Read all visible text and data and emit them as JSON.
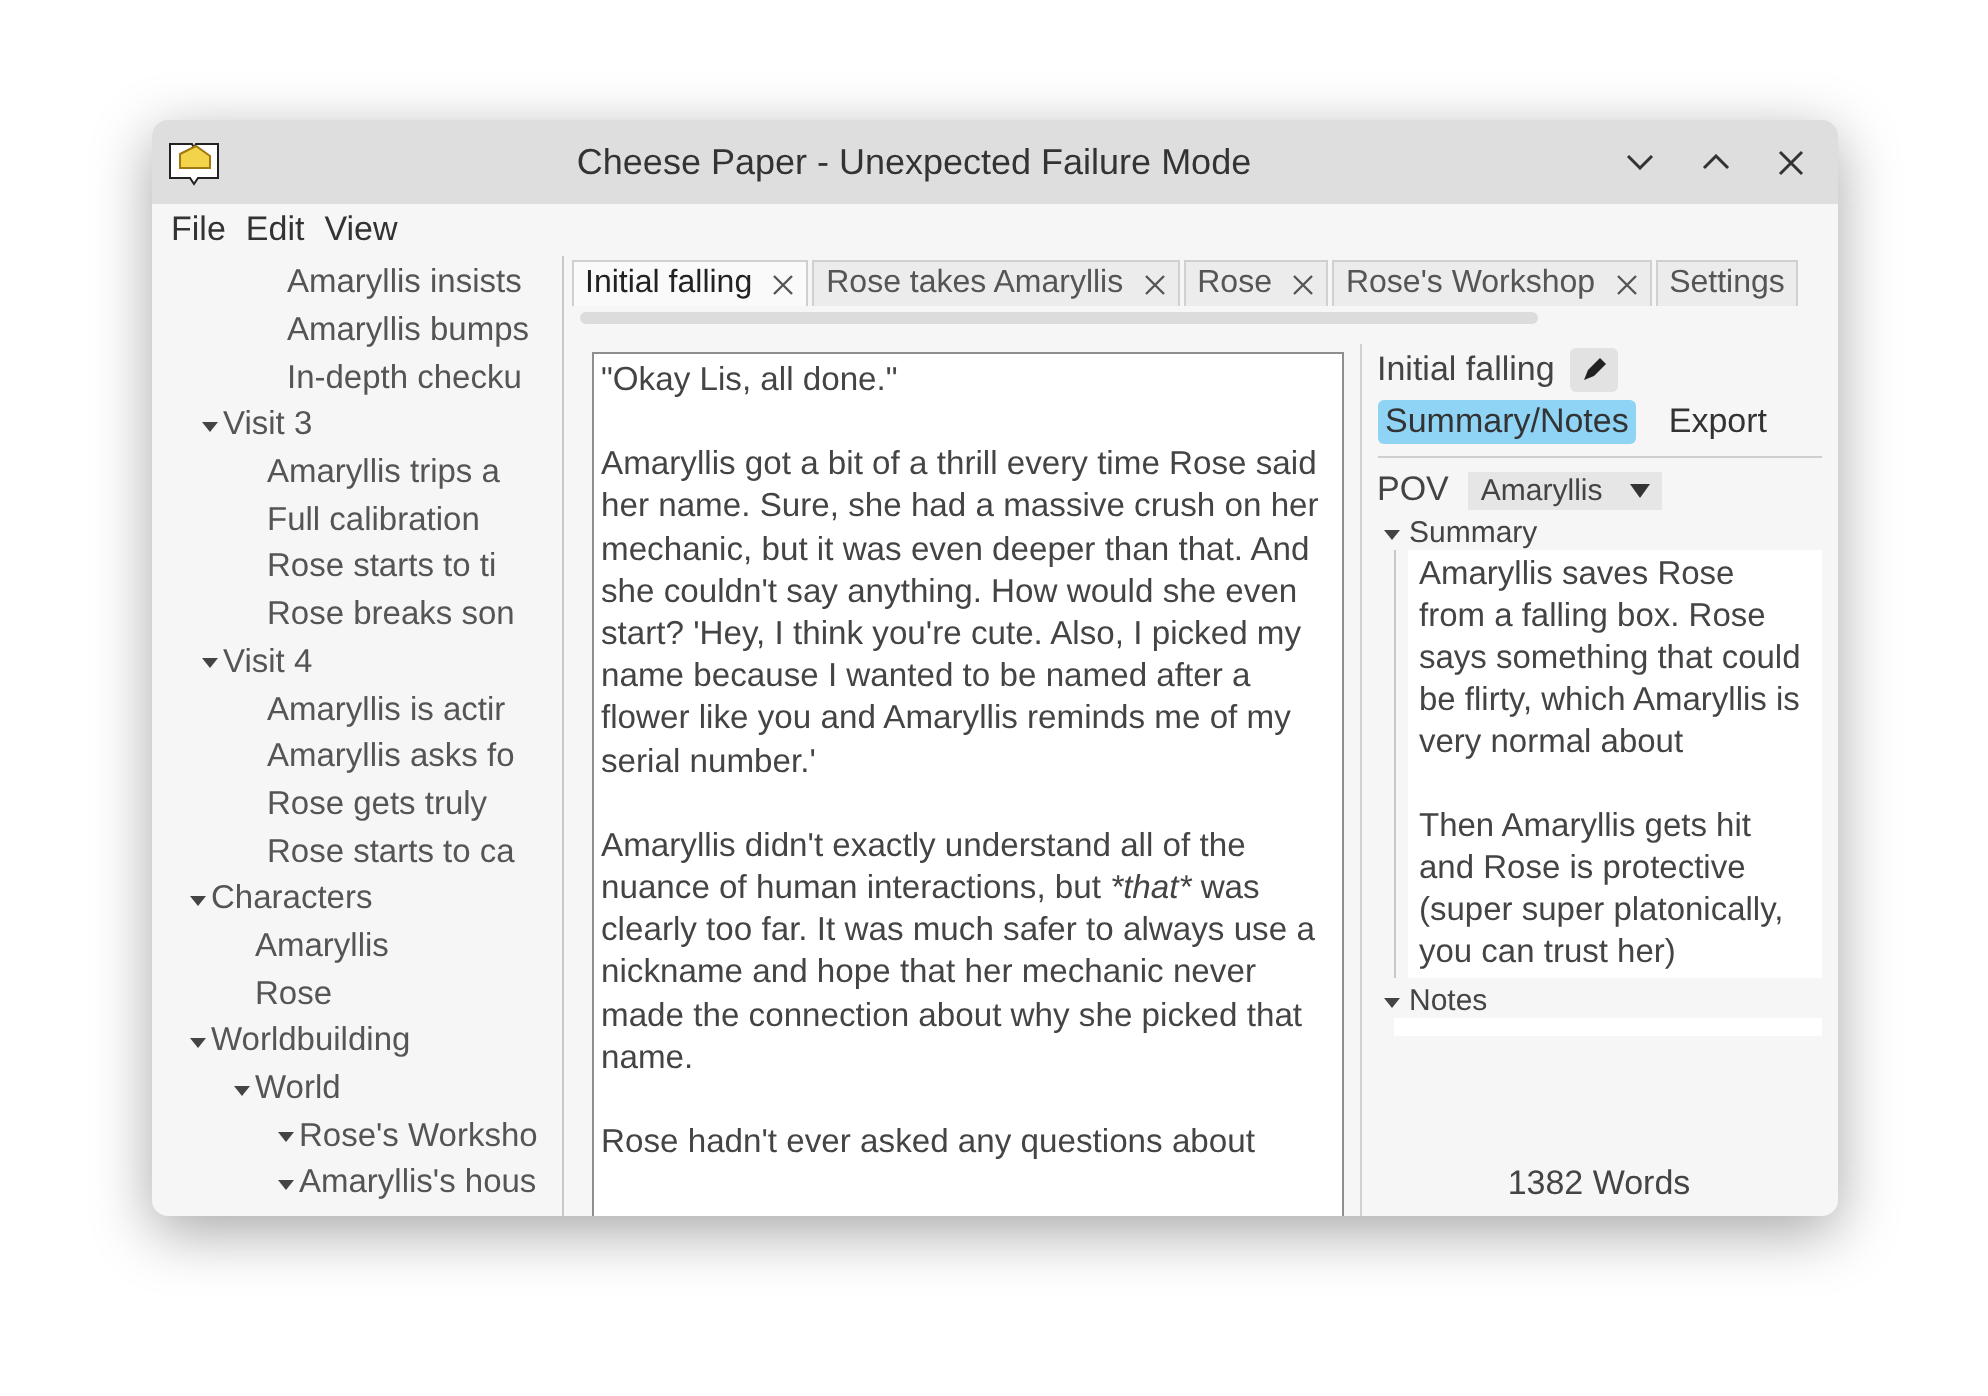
{
  "window": {
    "title": "Cheese Paper - Unexpected Failure Mode"
  },
  "menu": [
    "File",
    "Edit",
    "View"
  ],
  "tree": [
    {
      "label": "Amaryllis insists"
    },
    {
      "label": "Amaryllis bumps"
    },
    {
      "label": "In-depth checku"
    },
    {
      "label": "Visit 3",
      "expanded": true,
      "children": [
        {
          "label": "Amaryllis trips a"
        },
        {
          "label": "Full calibration"
        },
        {
          "label": "Rose starts to ti"
        },
        {
          "label": "Rose breaks son"
        }
      ]
    },
    {
      "label": "Visit 4",
      "expanded": true,
      "children": [
        {
          "label": "Amaryllis is actir"
        },
        {
          "label": "Amaryllis asks fo"
        },
        {
          "label": "Rose gets truly"
        },
        {
          "label": "Rose starts to ca"
        }
      ]
    }
  ],
  "tree_roots": [
    {
      "label": "Characters",
      "expanded": true,
      "children": [
        {
          "label": "Amaryllis"
        },
        {
          "label": "Rose"
        }
      ]
    },
    {
      "label": "Worldbuilding",
      "expanded": true,
      "children": [
        {
          "label": "World",
          "expanded": true,
          "children": [
            {
              "label": "Rose's Worksho",
              "expanded": true
            },
            {
              "label": "Amaryllis's hous",
              "expanded": true
            }
          ]
        }
      ]
    }
  ],
  "tabs": [
    {
      "label": "Initial falling",
      "selected": true,
      "closable": true
    },
    {
      "label": "Rose takes Amaryllis",
      "selected": false,
      "closable": true
    },
    {
      "label": "Rose",
      "selected": false,
      "closable": true
    },
    {
      "label": "Rose's Workshop",
      "selected": false,
      "closable": true
    },
    {
      "label": "Settings",
      "selected": false,
      "closable": false
    }
  ],
  "editor": {
    "paragraphs": [
      [
        {
          "text": "\"Okay Lis, all done.\""
        }
      ],
      [
        {
          "text": "Amaryllis got a bit of a thrill every time Rose said her name. Sure, she had a massive crush on her mechanic, but it was even deeper than that. And she couldn't say anything. How would she even start? 'Hey, I think you're cute. Also, I picked my name because I wanted to be named after a flower like you and Amaryllis reminds me of my serial number.'"
        }
      ],
      [
        {
          "text": "Amaryllis didn't exactly understand all of the nuance of human interactions, but "
        },
        {
          "text": "*that*",
          "italic": true
        },
        {
          "text": " was clearly too far. It was much safer to always use a nickname and hope that her mechanic never made the connection about why she picked that name."
        }
      ],
      [
        {
          "text": "Rose hadn't ever asked any questions about"
        }
      ]
    ]
  },
  "details": {
    "name": "Initial falling",
    "tabs": [
      {
        "label": "Summary/Notes",
        "selected": true
      },
      {
        "label": "Export",
        "selected": false
      }
    ],
    "pov_label": "POV",
    "pov_value": "Amaryllis",
    "sections": [
      {
        "title": "Summary",
        "expanded": true,
        "paragraphs": [
          "Amaryllis saves Rose from a falling box. Rose says something that could be flirty, which Amaryllis is very normal about",
          "Then Amaryllis gets hit and Rose is protective (super super platonically, you can trust her)"
        ]
      },
      {
        "title": "Notes",
        "expanded": true
      }
    ],
    "word_count": "1382 Words"
  }
}
